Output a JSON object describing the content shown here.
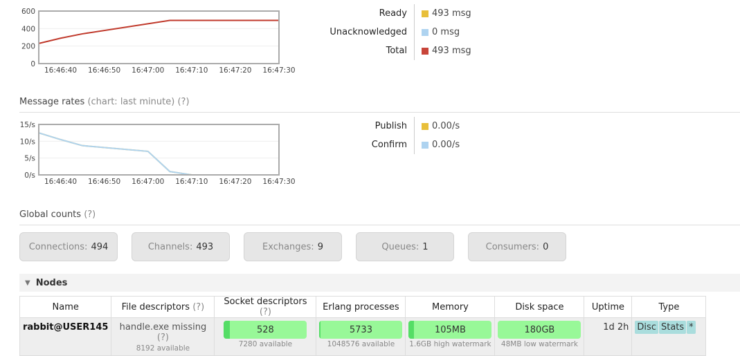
{
  "queued_chart": {
    "chart_data": {
      "type": "line",
      "x": [
        "16:46:35",
        "16:46:40",
        "16:46:45",
        "16:47:05",
        "16:47:10",
        "16:47:20",
        "16:47:30"
      ],
      "xticks": [
        "16:46:40",
        "16:46:50",
        "16:47:00",
        "16:47:10",
        "16:47:20",
        "16:47:30"
      ],
      "yticks": [
        "0",
        "200",
        "400",
        "600"
      ],
      "ylim": [
        0,
        600
      ],
      "series": [
        {
          "name": "Total",
          "color": "#c0392b",
          "values": [
            230,
            290,
            340,
            493,
            493,
            493,
            493
          ]
        },
        {
          "name": "Unacknowledged",
          "color": "#aed3f0",
          "values": [
            0,
            0,
            0,
            0,
            0,
            0,
            0
          ]
        }
      ]
    }
  },
  "queued_legend": [
    {
      "label": "Ready",
      "value": "493 msg",
      "color": "#e8bf3a"
    },
    {
      "label": "Unacknowledged",
      "value": "0 msg",
      "color": "#aed3f0"
    },
    {
      "label": "Total",
      "value": "493 msg",
      "color": "#c8453a"
    }
  ],
  "rates_header": {
    "title": "Message rates",
    "note": "(chart: last minute)",
    "help": "(?)"
  },
  "rates_chart": {
    "chart_data": {
      "type": "line",
      "x": [
        "16:46:35",
        "16:46:40",
        "16:46:45",
        "16:47:00",
        "16:47:05",
        "16:47:10",
        "16:47:20",
        "16:47:30"
      ],
      "xticks": [
        "16:46:40",
        "16:46:50",
        "16:47:00",
        "16:47:10",
        "16:47:20",
        "16:47:30"
      ],
      "yticks": [
        "0/s",
        "5/s",
        "10/s",
        "15/s"
      ],
      "ylim": [
        0,
        15
      ],
      "series": [
        {
          "name": "Publish",
          "color": "#e8bf3a",
          "values": [
            12.5,
            10.5,
            8.7,
            7,
            1,
            0,
            0,
            0
          ]
        },
        {
          "name": "Confirm",
          "color": "#aed3f0",
          "values": [
            12.5,
            10.5,
            8.7,
            7,
            1,
            0,
            0,
            0
          ]
        }
      ]
    }
  },
  "rates_legend": [
    {
      "label": "Publish",
      "value": "0.00/s",
      "color": "#e8bf3a"
    },
    {
      "label": "Confirm",
      "value": "0.00/s",
      "color": "#aed3f0"
    }
  ],
  "global": {
    "title": "Global counts",
    "help": "(?)",
    "counts": [
      {
        "label": "Connections:",
        "value": "494"
      },
      {
        "label": "Channels:",
        "value": "493"
      },
      {
        "label": "Exchanges:",
        "value": "9"
      },
      {
        "label": "Queues:",
        "value": "1"
      },
      {
        "label": "Consumers:",
        "value": "0"
      }
    ]
  },
  "nodes": {
    "title": "Nodes",
    "headers": [
      "Name",
      "File descriptors",
      "Socket descriptors",
      "Erlang processes",
      "Memory",
      "Disk space",
      "Uptime",
      "Type"
    ],
    "help": "(?)",
    "row": {
      "name": "rabbit@USER145",
      "fd": "handle.exe missing",
      "fd_sub": "8192 available",
      "sock": "528",
      "sock_sub": "7280 available",
      "sock_fill": 7,
      "erl": "5733",
      "erl_sub": "1048576 available",
      "erl_fill": 1,
      "mem": "105MB",
      "mem_sub": "1.6GB high watermark",
      "mem_fill": 6,
      "disk": "180GB",
      "disk_sub": "48MB low watermark",
      "uptime": "1d 2h",
      "types": [
        "Disc",
        "Stats",
        "*"
      ]
    }
  }
}
